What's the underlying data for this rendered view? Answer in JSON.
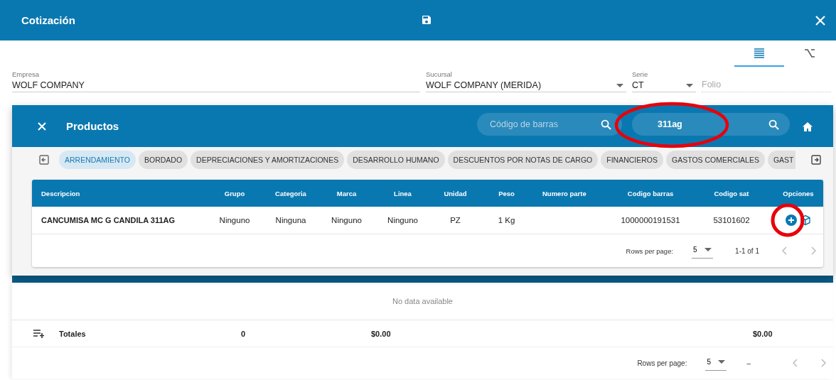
{
  "header": {
    "title": "Cotización"
  },
  "view_tabs": [
    {
      "kind": "list",
      "selected": true
    },
    {
      "kind": "formula",
      "selected": false
    }
  ],
  "form": {
    "empresa": {
      "label": "Empresa",
      "value": "WOLF COMPANY"
    },
    "sucursal": {
      "label": "Sucursal",
      "value": "WOLF COMPANY (MERIDA)"
    },
    "serie": {
      "label": "Serie",
      "value": "CT"
    },
    "folio": {
      "placeholder": "Folio"
    }
  },
  "dialog": {
    "title": "Productos",
    "barcode_search": {
      "placeholder": "Código de barras"
    },
    "product_search": {
      "value": "311ag"
    },
    "categories": [
      {
        "label": "ARRENDAMIENTO",
        "selected": true
      },
      {
        "label": "BORDADO",
        "selected": false
      },
      {
        "label": "DEPRECIACIONES Y AMORTIZACIONES",
        "selected": false
      },
      {
        "label": "DESARROLLO HUMANO",
        "selected": false
      },
      {
        "label": "DESCUENTOS POR NOTAS DE CARGO",
        "selected": false
      },
      {
        "label": "FINANCIEROS",
        "selected": false
      },
      {
        "label": "GASTOS COMERCIALES",
        "selected": false
      },
      {
        "label": "GAST",
        "selected": false
      }
    ],
    "table": {
      "columns": [
        "Descripcion",
        "Grupo",
        "Categoria",
        "Marca",
        "Linea",
        "Unidad",
        "Peso",
        "Numero parte",
        "Codigo barras",
        "Codigo sat",
        "Opciones"
      ],
      "rows": [
        {
          "descripcion": "CANCUMISA MC G CANDILA 311AG",
          "grupo": "Ninguno",
          "categoria": "Ninguna",
          "marca": "Ninguno",
          "linea": "Ninguno",
          "unidad": "PZ",
          "peso": "1 Kg",
          "codigo_barras": "1000000191531",
          "codigo_sat": "53101602"
        }
      ]
    },
    "pagination": {
      "rows_per_page_label": "Rows per page:",
      "rows_per_page": "5",
      "range": "1-1 of 1"
    }
  },
  "page_table": {
    "empty_text": "No data available",
    "totals": {
      "label": "Totales",
      "cantidad": "0",
      "subtotal": "$0.00",
      "total": "$0.00"
    },
    "pagination": {
      "rows_per_page_label": "Rows per page:",
      "rows_per_page": "5",
      "range": "–"
    }
  }
}
